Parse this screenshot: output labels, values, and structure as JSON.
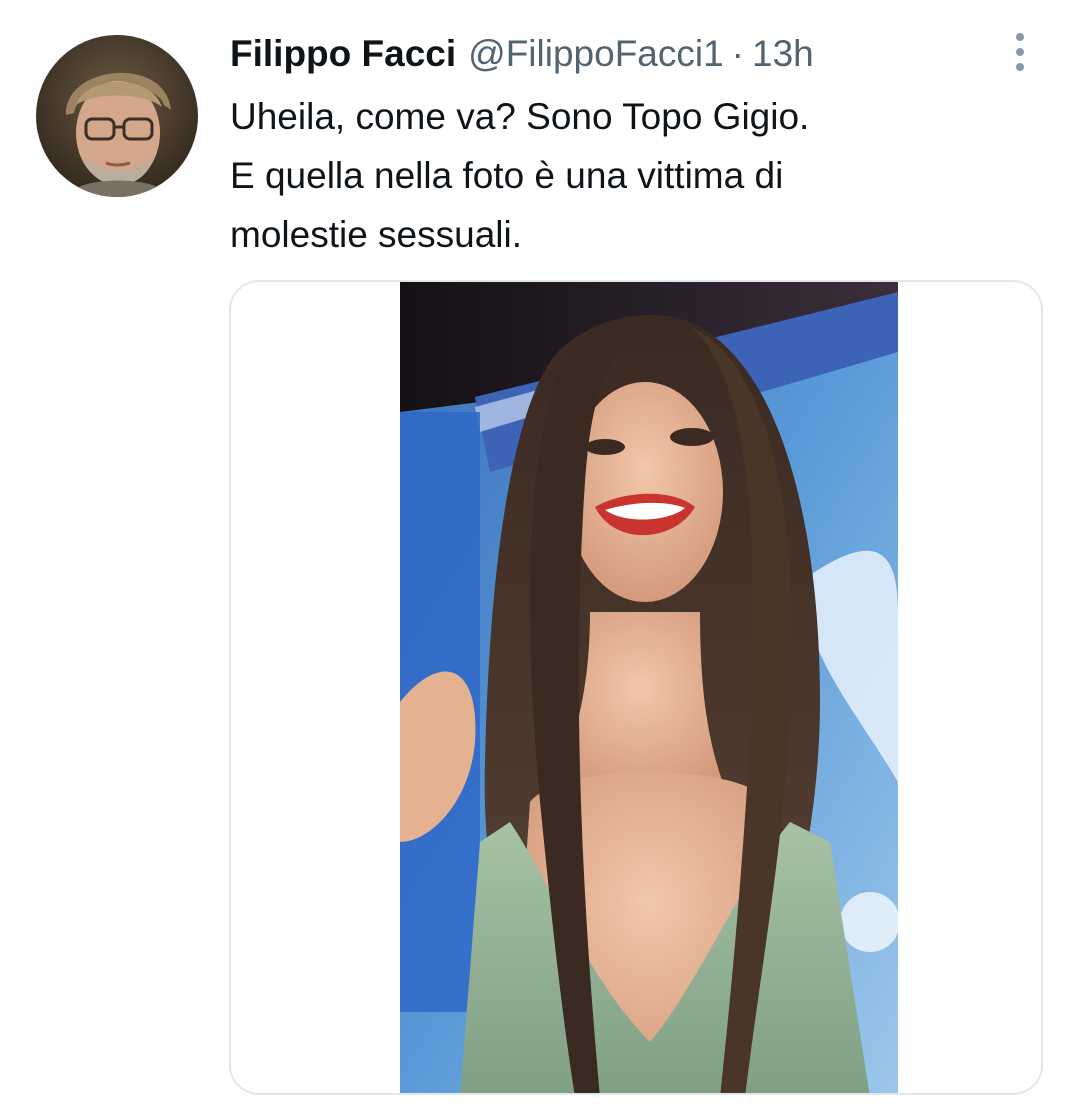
{
  "tweet": {
    "author": {
      "display_name": "Filippo Facci",
      "handle": "@FilippoFacci1",
      "avatar_icon": "profile-photo"
    },
    "separator": "·",
    "timestamp": "13h",
    "more_icon": "more-vertical-icon",
    "text_lines": [
      "Uheila, come va? Sono Topo Gigio.",
      "E quella nella foto è una vittima di",
      "molestie sessuali."
    ],
    "media": {
      "type": "photo"
    }
  },
  "colors": {
    "text_primary": "#0f1419",
    "text_secondary": "#536471",
    "card_border": "#e3e7ea",
    "icon_gray": "#8b98a5"
  }
}
